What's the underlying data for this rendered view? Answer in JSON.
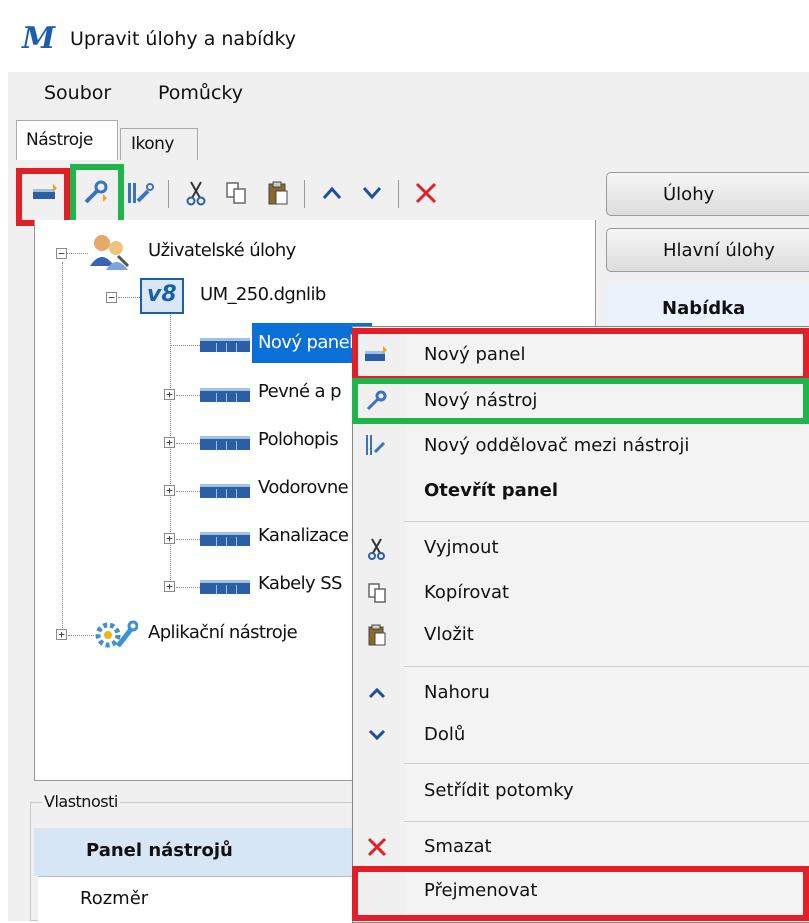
{
  "window": {
    "title": "Upravit úlohy a nabídky",
    "app_icon_glyph": "M"
  },
  "menu": {
    "items": [
      "Soubor",
      "Pomůcky"
    ]
  },
  "tabs": {
    "tools": "Nástroje",
    "icons": "Ikony"
  },
  "toolbar": {
    "icons": [
      "new-panel-icon",
      "new-tool-icon",
      "new-separator-icon",
      "cut-icon",
      "copy-icon",
      "paste-icon",
      "move-up-icon",
      "move-down-icon",
      "delete-icon"
    ]
  },
  "tree": {
    "root": "Uživatelské úlohy",
    "library": "UM_250.dgnlib",
    "library_badge": "v8",
    "children": [
      "Nový panel",
      "Pevné a p",
      "Polohopis",
      "Vodorovne",
      "Kanalizace",
      "Kabely SS"
    ],
    "app_tools": "Aplikační nástroje"
  },
  "properties": {
    "group_label": "Vlastnosti",
    "header": "Panel nástrojů",
    "row_label": "Rozměr"
  },
  "sidebar": {
    "tasks": "Úlohy",
    "main_tasks": "Hlavní úlohy",
    "menu": "Nabídka"
  },
  "context_menu": {
    "new_panel": "Nový panel",
    "new_tool": "Nový nástroj",
    "new_separator": "Nový oddělovač mezi nástroji",
    "open_panel": "Otevřít panel",
    "cut": "Vyjmout",
    "copy": "Kopírovat",
    "paste": "Vložit",
    "up": "Nahoru",
    "down": "Dolů",
    "sort": "Setřídit potomky",
    "delete": "Smazat",
    "rename": "Přejmenovat"
  },
  "colors": {
    "highlight_red": "#e41e26",
    "highlight_green": "#1fb54a",
    "selection": "#0a6fd6",
    "delete_red": "#e41e26",
    "arrow_blue": "#1c4f9c"
  }
}
